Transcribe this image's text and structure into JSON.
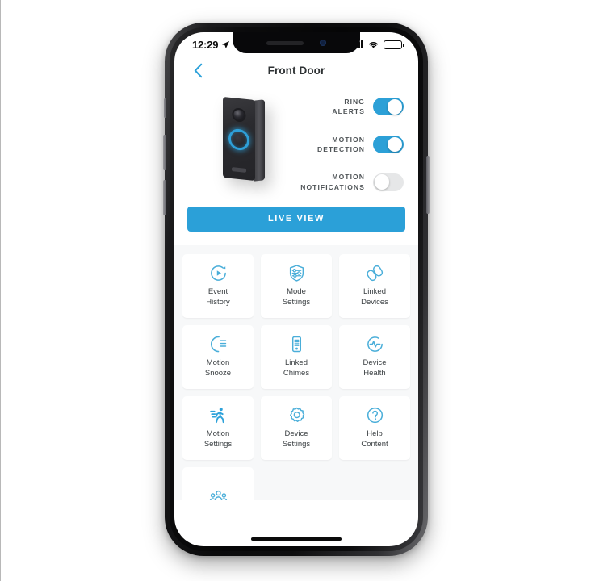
{
  "status_bar": {
    "time": "12:29",
    "location_icon": "location-arrow-icon",
    "signal_icon": "cellular-signal-icon",
    "wifi_icon": "wifi-icon",
    "battery_icon": "battery-icon"
  },
  "nav": {
    "back_icon": "chevron-left-icon",
    "title": "Front Door"
  },
  "device": {
    "image_name": "ring-video-doorbell-wired",
    "accent_color": "#2ca0d7"
  },
  "toggles": [
    {
      "label": "RING\nALERTS",
      "state": "on",
      "name": "ring-alerts"
    },
    {
      "label": "MOTION\nDETECTION",
      "state": "on",
      "name": "motion-detection"
    },
    {
      "label": "MOTION\nNOTIFICATIONS",
      "state": "off",
      "name": "motion-notifications"
    }
  ],
  "live_view": {
    "label": "LIVE VIEW",
    "color": "#2ba0d8"
  },
  "tiles": [
    {
      "label": "Event\nHistory",
      "icon": "event-history-icon"
    },
    {
      "label": "Mode\nSettings",
      "icon": "mode-settings-icon"
    },
    {
      "label": "Linked\nDevices",
      "icon": "linked-devices-icon"
    },
    {
      "label": "Motion\nSnooze",
      "icon": "motion-snooze-icon"
    },
    {
      "label": "Linked\nChimes",
      "icon": "linked-chimes-icon"
    },
    {
      "label": "Device\nHealth",
      "icon": "device-health-icon"
    },
    {
      "label": "Motion\nSettings",
      "icon": "motion-settings-icon"
    },
    {
      "label": "Device\nSettings",
      "icon": "device-settings-icon"
    },
    {
      "label": "Help\nContent",
      "icon": "help-content-icon"
    },
    {
      "label": "",
      "icon": "shared-users-icon"
    }
  ],
  "colors": {
    "accent": "#2ca0d7",
    "icon_blue": "#4aaed9",
    "text_dark": "#3b4043",
    "tile_bg": "#ffffff",
    "page_bg": "#f7f8f9"
  }
}
